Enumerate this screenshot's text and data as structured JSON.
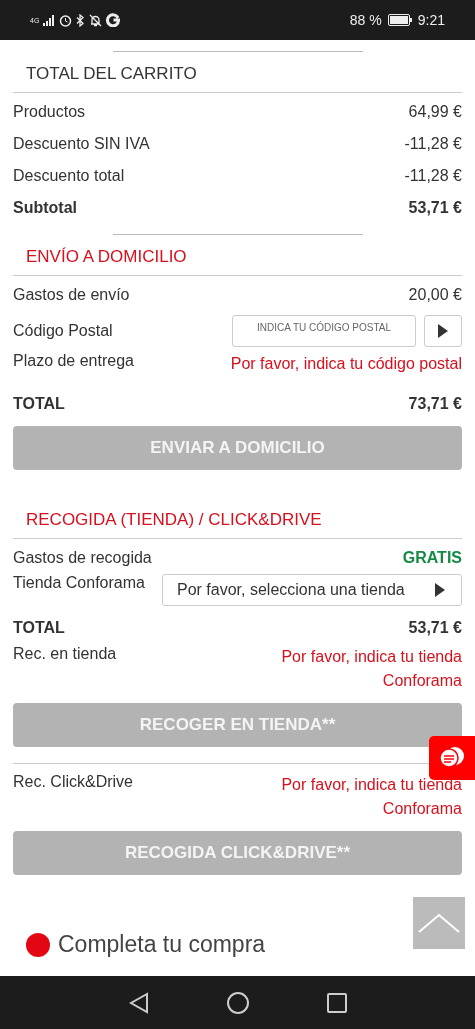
{
  "status_bar": {
    "network": "4G",
    "battery": "88 %",
    "time": "9:21"
  },
  "sections": [
    {
      "heading": "TOTAL DEL CARRITO",
      "accent": false,
      "divider_above": true,
      "rows": [
        {
          "kind": "amount",
          "label": "Productos",
          "value": "64,99 €"
        },
        {
          "kind": "amount",
          "label": "Descuento SIN IVA",
          "value": "-11,28 €"
        },
        {
          "kind": "amount",
          "label": "Descuento total",
          "value": "-11,28 €"
        },
        {
          "kind": "total",
          "label": "Subtotal",
          "value": "53,71 €"
        }
      ]
    },
    {
      "heading": "ENVÍO A DOMICILIO",
      "accent": true,
      "divider_above": true,
      "rows": [
        {
          "kind": "amount",
          "label": "Gastos de envío",
          "value": "20,00 €"
        },
        {
          "kind": "postcode",
          "label": "Código Postal",
          "placeholder": "INDICA TU CÓDIGO POSTAL"
        },
        {
          "kind": "notice",
          "label": "Plazo de entrega",
          "value": "Por favor, indica tu código postal"
        },
        {
          "kind": "total",
          "label": "TOTAL",
          "value": "73,71 €"
        },
        {
          "kind": "button",
          "label": "ENVIAR A DOMICILIO",
          "disabled": true
        }
      ]
    },
    {
      "heading": "RECOGIDA (TIENDA) / CLICK&DRIVE",
      "accent": true,
      "divider_above": false,
      "rows": [
        {
          "kind": "free",
          "label": "Gastos de recogida",
          "value": "GRATIS"
        },
        {
          "kind": "store_select",
          "label": "Tienda Conforama",
          "value": "Por favor, selecciona una tienda"
        },
        {
          "kind": "total",
          "label": "TOTAL",
          "value": "53,71 €"
        },
        {
          "kind": "notice",
          "label": "Rec. en tienda",
          "value": "Por favor, indica tu tienda Conforama"
        },
        {
          "kind": "button",
          "label": "RECOGER EN TIENDA**",
          "disabled": true
        },
        {
          "kind": "rule"
        },
        {
          "kind": "notice",
          "label": "Rec. Click&Drive",
          "value": "Por favor, indica tu tienda Conforama"
        },
        {
          "kind": "button",
          "label": "RECOGIDA CLICK&DRIVE**",
          "disabled": true
        }
      ]
    }
  ],
  "footer": {
    "title": "Completa tu compra"
  }
}
